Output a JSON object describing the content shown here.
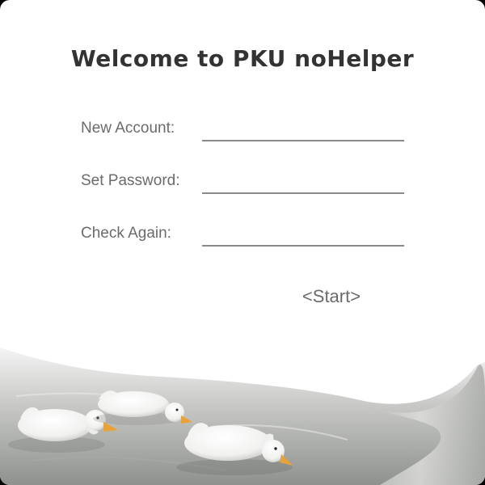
{
  "window": {
    "title": "Welcome to PKU noHelper"
  },
  "form": {
    "fields": [
      {
        "label": "New Account:",
        "value": "",
        "placeholder": ""
      },
      {
        "label": "Set Password:",
        "value": "",
        "placeholder": ""
      },
      {
        "label": "Check Again:",
        "value": "",
        "placeholder": ""
      }
    ],
    "start_label": "<Start>"
  },
  "illustration": {
    "subject": "ducks-swimming-on-water"
  }
}
